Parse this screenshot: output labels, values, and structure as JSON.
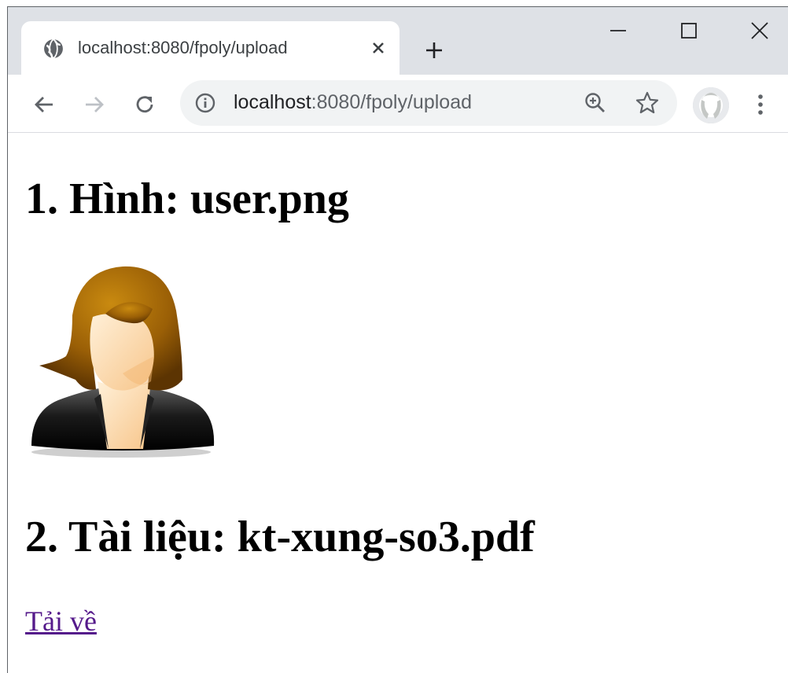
{
  "browser": {
    "tab_title": "localhost:8080/fpoly/upload",
    "url_host": "localhost",
    "url_path": ":8080/fpoly/upload"
  },
  "page": {
    "image_heading": "1. Hình: user.png",
    "document_heading": "2. Tài liệu: kt-xung-so3.pdf",
    "download_link": "Tải về"
  },
  "icons": {
    "favicon": "globe-icon",
    "close": "close-icon",
    "new_tab": "plus-icon",
    "minimize": "minimize-icon",
    "maximize": "maximize-icon",
    "window_close": "window-close-icon",
    "back": "back-arrow-icon",
    "forward": "forward-arrow-icon",
    "reload": "reload-icon",
    "info": "info-icon",
    "zoom": "zoom-in-icon",
    "bookmark": "star-icon",
    "profile": "avatar-icon",
    "menu": "kebab-menu-icon"
  },
  "colors": {
    "titlebar": "#dee1e6",
    "omnibox": "#f1f3f4",
    "visited_link": "#551a8b"
  }
}
